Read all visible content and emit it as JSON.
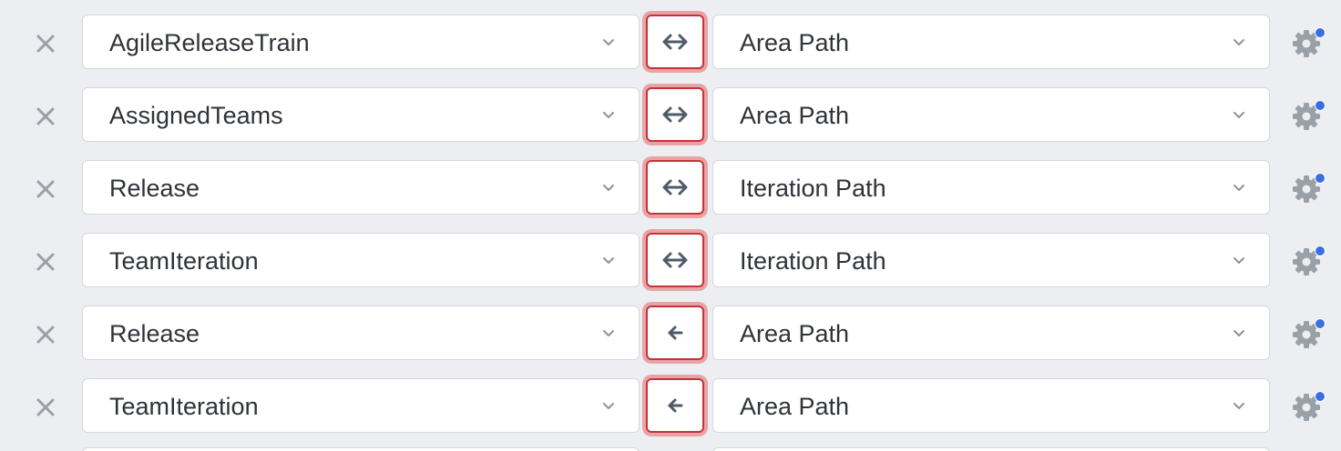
{
  "mappings": [
    {
      "source_field": "AgileReleaseTrain",
      "direction": "bidirectional",
      "direction_icon": "arrows-left-right-icon",
      "target_field": "Area Path"
    },
    {
      "source_field": "AssignedTeams",
      "direction": "bidirectional",
      "direction_icon": "arrows-left-right-icon",
      "target_field": "Area Path"
    },
    {
      "source_field": "Release",
      "direction": "bidirectional",
      "direction_icon": "arrows-left-right-icon",
      "target_field": "Iteration Path"
    },
    {
      "source_field": "TeamIteration",
      "direction": "bidirectional",
      "direction_icon": "arrows-left-right-icon",
      "target_field": "Iteration Path"
    },
    {
      "source_field": "Release",
      "direction": "right-to-left",
      "direction_icon": "arrow-left-icon",
      "target_field": "Area Path"
    },
    {
      "source_field": "TeamIteration",
      "direction": "right-to-left",
      "direction_icon": "arrow-left-icon",
      "target_field": "Area Path"
    }
  ],
  "icons": {
    "remove": "close-icon",
    "dropdown": "chevron-down-icon",
    "settings": "gear-icon",
    "settings_indicator": "notification-dot"
  },
  "colors": {
    "background": "#edeef1",
    "direction_border": "#c8313a",
    "direction_ring": "#e8a4a5",
    "indicator_dot": "#3b6fe0",
    "icon_gray": "#9aa0a8",
    "arrow": "#4f5b6b"
  }
}
